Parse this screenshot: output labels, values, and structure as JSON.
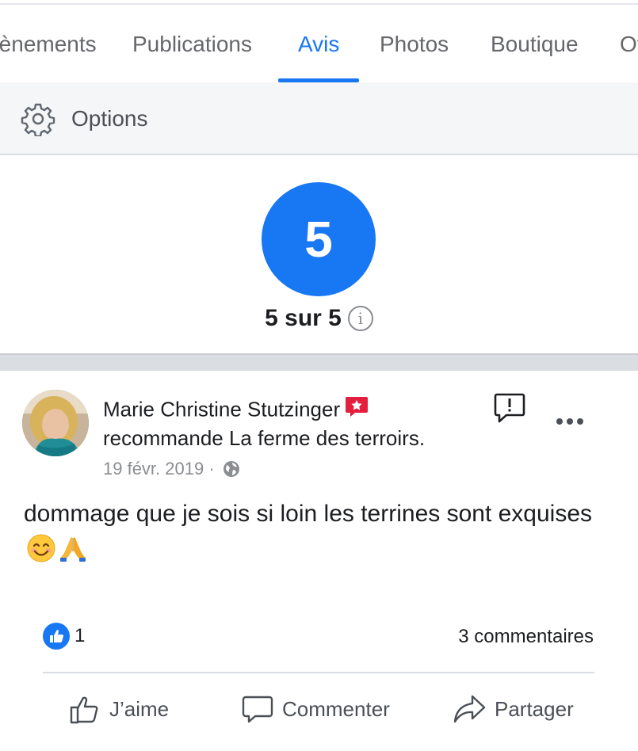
{
  "tabs": [
    {
      "label": "Évènements"
    },
    {
      "label": "Publications"
    },
    {
      "label": "Avis"
    },
    {
      "label": "Photos"
    },
    {
      "label": "Boutique"
    },
    {
      "label": "Ot"
    }
  ],
  "active_tab": "Avis",
  "options": {
    "label": "Options",
    "icon": "gear-icon"
  },
  "rating": {
    "score": "5",
    "text": "5 sur 5",
    "info_icon": "i"
  },
  "review": {
    "author": "Marie Christine Stutzinger",
    "recommend_text": "recommande La ferme des terroirs.",
    "date": "19 févr. 2019",
    "separator": "·",
    "privacy_icon": "globe-icon",
    "body": "dommage que je sois si loin les terrines sont exquises",
    "emojis": [
      "smiling-face-emoji",
      "folded-hands-emoji"
    ],
    "like_count": "1",
    "comments_count": "3 commentaires"
  },
  "actions": {
    "like": "J’aime",
    "comment": "Commenter",
    "share": "Partager"
  },
  "colors": {
    "accent": "#1877f2",
    "badge": "#e41e3f",
    "muted": "#65676b"
  }
}
